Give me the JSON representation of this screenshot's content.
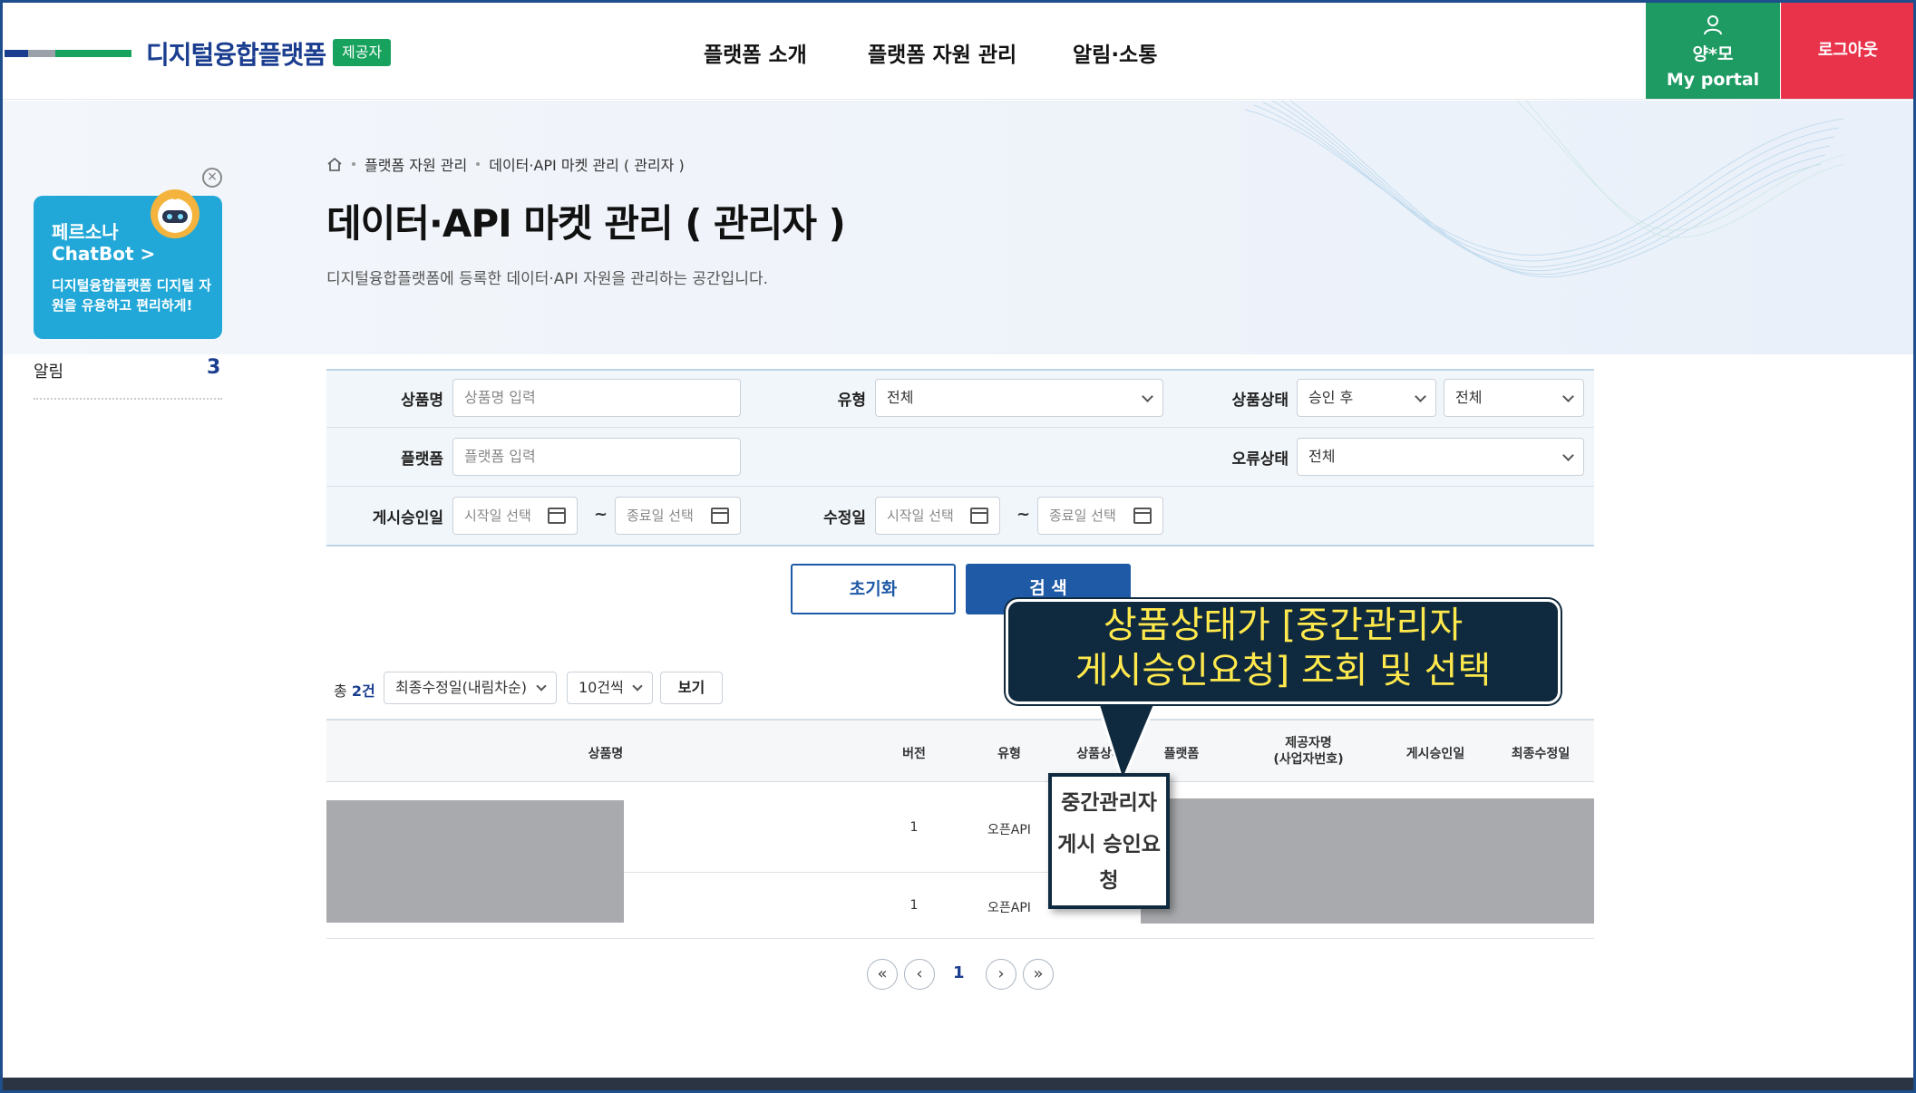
{
  "header": {
    "logo_title": "디지털융합플랫폼",
    "logo_badge": "제공자",
    "nav": [
      "플랫폼 소개",
      "플랫폼 자원 관리",
      "알림·소통"
    ],
    "user_name": "양*모",
    "portal_label": "My portal",
    "logout_label": "로그아웃",
    "colors": {
      "navy": "#1a3d8f",
      "green": "#1e9b62",
      "red": "#e8334b"
    }
  },
  "breadcrumb": [
    "플랫폼 자원 관리",
    "데이터·API 마켓 관리 ( 관리자 )"
  ],
  "page": {
    "title": "데이터·API 마켓 관리 ( 관리자 )",
    "description": "디지털융합플랫폼에 등록한 데이터·API 자원을 관리하는 공간입니다."
  },
  "chatbot": {
    "line1": "페르소나",
    "line2": "ChatBot",
    "line2_arrow": ">",
    "desc": "디지털융합플랫폼 디지털 자원을 유용하고 편리하게!",
    "close": "×"
  },
  "alarm": {
    "label": "알림",
    "count": "3"
  },
  "search": {
    "product_name_label": "상품명",
    "product_name_placeholder": "상품명 입력",
    "type_label": "유형",
    "type_value": "전체",
    "status_label": "상품상태",
    "status_value1": "승인 후",
    "status_value2": "전체",
    "platform_label": "플랫폼",
    "platform_placeholder": "플랫폼 입력",
    "error_label": "오류상태",
    "error_value": "전체",
    "approve_date_label": "게시승인일",
    "modify_date_label": "수정일",
    "start_placeholder": "시작일 선택",
    "end_placeholder": "종료일 선택",
    "tilde": "~",
    "reset_label": "초기화",
    "search_label": "검 색"
  },
  "list": {
    "total_prefix": "총 ",
    "total_count": "2건",
    "sort_value": "최종수정일(내림차순)",
    "page_size_value": "10건씩",
    "view_label": "보기"
  },
  "table": {
    "headers": {
      "name": "상품명",
      "version": "버전",
      "type": "유형",
      "status": "상품상태",
      "platform": "플랫폼",
      "provider1": "제공자명",
      "provider2": "(사업자번호)",
      "approve": "게시승인일",
      "modified": "최종수정일"
    },
    "rows": [
      {
        "version": "1",
        "type": "오픈API"
      },
      {
        "version": "1",
        "type": "오픈API"
      }
    ]
  },
  "pagination": {
    "first": "«",
    "prev": "‹",
    "current": "1",
    "next": "›",
    "last": "»"
  },
  "callout": {
    "line1": "상품상태가 [중간관리자",
    "line2": "게시승인요청] 조회 및 선택",
    "highlight_line1": "중간관리자",
    "highlight_line2": "게시 승인요",
    "highlight_line3": "청"
  }
}
